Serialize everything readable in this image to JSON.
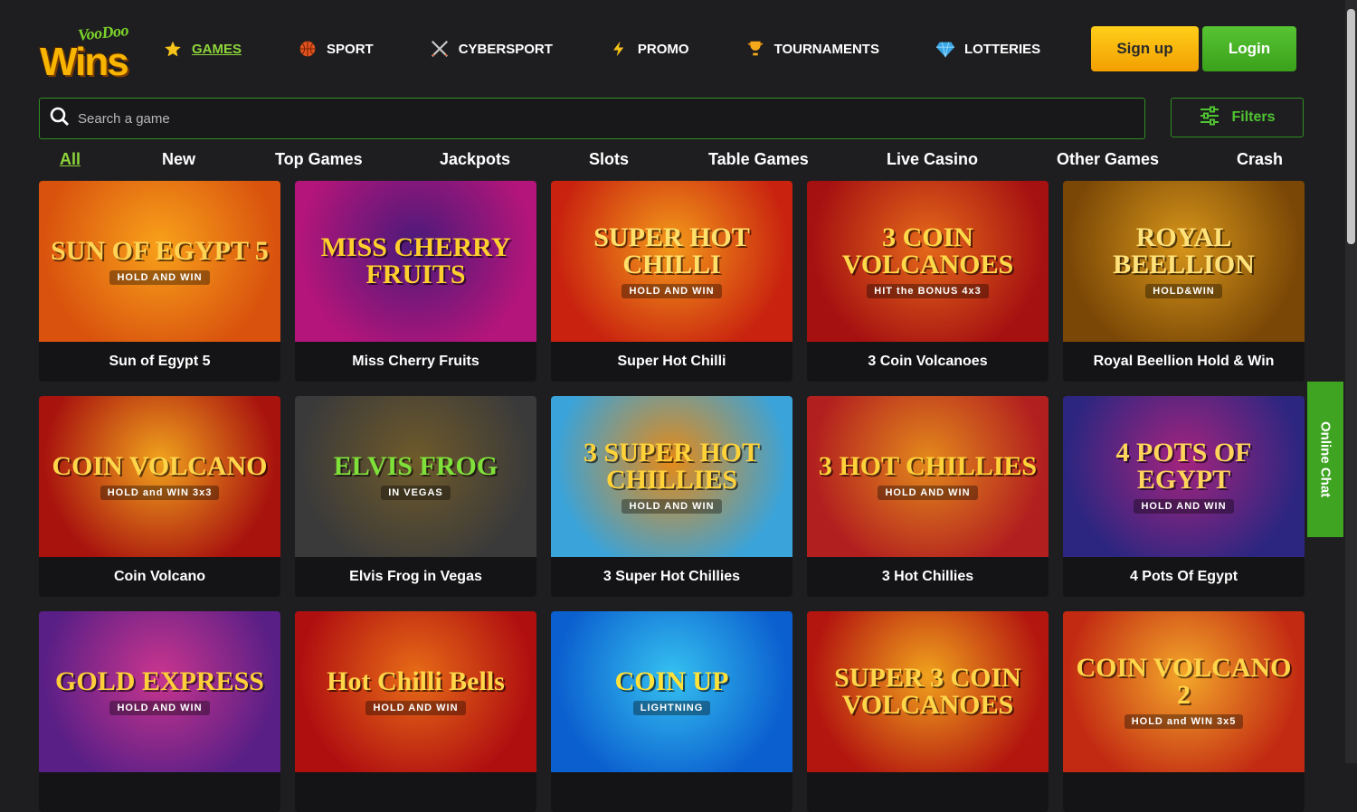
{
  "logo": {
    "top_text": "VooDoo",
    "main_text": "Wins"
  },
  "nav": [
    {
      "label": "GAMES",
      "icon": "star-icon",
      "active": true
    },
    {
      "label": "SPORT",
      "icon": "basketball-icon"
    },
    {
      "label": "CYBERSPORT",
      "icon": "crossed-swords-icon"
    },
    {
      "label": "PROMO",
      "icon": "lightning-icon"
    },
    {
      "label": "TOURNAMENTS",
      "icon": "trophy-icon"
    },
    {
      "label": "LOTTERIES",
      "icon": "diamond-icon"
    }
  ],
  "auth": {
    "signup_label": "Sign up",
    "login_label": "Login"
  },
  "search": {
    "placeholder": "Search a game"
  },
  "filters": {
    "label": "Filters"
  },
  "tabs": [
    {
      "label": "All",
      "active": true
    },
    {
      "label": "New"
    },
    {
      "label": "Top Games"
    },
    {
      "label": "Jackpots"
    },
    {
      "label": "Slots"
    },
    {
      "label": "Table Games"
    },
    {
      "label": "Live Casino"
    },
    {
      "label": "Other Games"
    },
    {
      "label": "Crash"
    }
  ],
  "games": [
    {
      "title": "Sun of Egypt 5",
      "art": "SUN OF EGYPT 5",
      "badge": "HOLD AND WIN",
      "bg": "#d9530e",
      "bg2": "#f8a11a",
      "fg": "#ffd455"
    },
    {
      "title": "Miss Cherry Fruits",
      "art": "MISS CHERRY FRUITS",
      "badge": "",
      "bg": "#b3157a",
      "bg2": "#4a1a7a",
      "fg": "#ffcf2e"
    },
    {
      "title": "Super Hot Chilli",
      "art": "SUPER HOT CHILLI",
      "badge": "HOLD AND WIN",
      "bg": "#c9230f",
      "bg2": "#f39a1a",
      "fg": "#ffe06a"
    },
    {
      "title": "3 Coin Volcanoes",
      "art": "3 COIN VOLCANOES",
      "badge": "HIT the BONUS 4x3",
      "bg": "#a51111",
      "bg2": "#e5691a",
      "fg": "#ffd84a"
    },
    {
      "title": "Royal Beellion Hold & Win",
      "art": "ROYAL BEELLION",
      "badge": "HOLD&WIN",
      "bg": "#7a4706",
      "bg2": "#d6951a",
      "fg": "#ffe27a"
    },
    {
      "title": "Coin Volcano",
      "art": "COIN VOLCANO",
      "badge": "HOLD and WIN 3x3",
      "bg": "#a8130e",
      "bg2": "#f0a21d",
      "fg": "#ffd54a"
    },
    {
      "title": "Elvis Frog in Vegas",
      "art": "ELVIS FROG",
      "badge": "IN VEGAS",
      "bg": "#3a3a3a",
      "bg2": "#6f5a2a",
      "fg": "#7fe03a"
    },
    {
      "title": "3 Super Hot Chillies",
      "art": "3 SUPER HOT CHILLIES",
      "badge": "HOLD AND WIN",
      "bg": "#3aa3d9",
      "bg2": "#e68a17",
      "fg": "#ffd23a"
    },
    {
      "title": "3 Hot Chillies",
      "art": "3 HOT CHILLIES",
      "badge": "HOLD AND WIN",
      "bg": "#b21f1f",
      "bg2": "#e3891c",
      "fg": "#ffd23a"
    },
    {
      "title": "4 Pots Of Egypt",
      "art": "4 POTS OF EGYPT",
      "badge": "HOLD AND WIN",
      "bg": "#2d2680",
      "bg2": "#a4247e",
      "fg": "#ffd45a"
    },
    {
      "title": "",
      "art": "GOLD EXPRESS",
      "badge": "HOLD AND WIN",
      "bg": "#5a1f86",
      "bg2": "#c9358e",
      "fg": "#ffcf3a"
    },
    {
      "title": "",
      "art": "Hot Chilli Bells",
      "badge": "HOLD AND WIN",
      "bg": "#b00f10",
      "bg2": "#e76c17",
      "fg": "#ffd54a"
    },
    {
      "title": "",
      "art": "COIN UP",
      "badge": "LIGHTNING",
      "bg": "#0b5fcf",
      "bg2": "#35c1f0",
      "fg": "#ffe23a"
    },
    {
      "title": "",
      "art": "SUPER 3 COIN VOLCANOES",
      "badge": "",
      "bg": "#b3160f",
      "bg2": "#f0a21d",
      "fg": "#ffd54a"
    },
    {
      "title": "",
      "art": "COIN VOLCANO 2",
      "badge": "HOLD and WIN 3x5",
      "bg": "#c22a12",
      "bg2": "#f3a72a",
      "fg": "#ffd54a"
    }
  ],
  "online_chat": {
    "label": "Online Chat"
  },
  "colors": {
    "accent_green": "#8ed53a",
    "signup_yellow": "#f7b500",
    "login_green": "#3aa11a",
    "background": "#1e1e20"
  }
}
